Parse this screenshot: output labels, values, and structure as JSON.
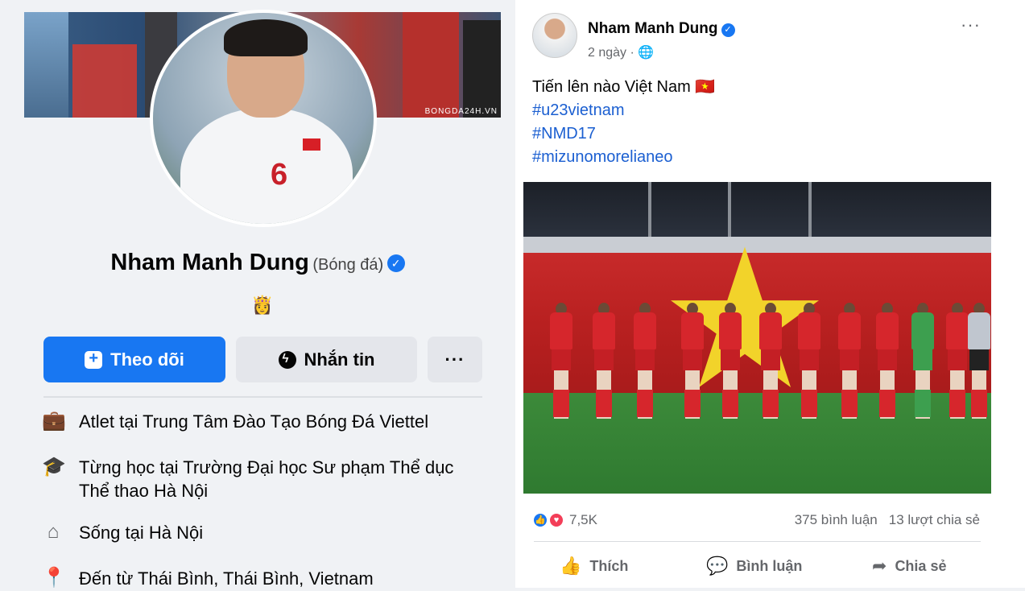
{
  "profile": {
    "name": "Nham Manh Dung",
    "category": "(Bóng đá)",
    "emoji": "👸",
    "follow_label": "Theo dõi",
    "message_label": "Nhắn tin",
    "more_label": "···",
    "cover_watermark": "BONGDA24H.VN",
    "info": [
      {
        "icon": "briefcase-icon",
        "text": "Atlet tại Trung Tâm Đào Tạo Bóng Đá Viettel"
      },
      {
        "icon": "graduation-cap-icon",
        "text": "Từng học tại Trường Đại học Sư phạm Thể dục Thể thao Hà Nội"
      },
      {
        "icon": "home-icon",
        "text": "Sống tại Hà Nội"
      },
      {
        "icon": "location-pin-icon",
        "text": "Đến từ Thái Bình, Thái Bình, Vietnam"
      }
    ]
  },
  "post": {
    "author": "Nham Manh Dung",
    "time": "2 ngày · ",
    "menu_label": "···",
    "text": "Tiến lên nào Việt Nam 🇻🇳",
    "hashtags": [
      "#u23vietnam",
      "#NMD17",
      "#mizunomorelianeo"
    ],
    "reaction_count": "7,5K",
    "comments": "375 bình luận",
    "shares": "13 lượt chia sẻ",
    "like_label": "Thích",
    "comment_label": "Bình luận",
    "share_label": "Chia sẻ"
  },
  "colors": {
    "accent": "#1877f2",
    "page_bg": "#f0f2f5",
    "hashtag": "#1b5fd1",
    "secondary_text": "#65676b"
  }
}
